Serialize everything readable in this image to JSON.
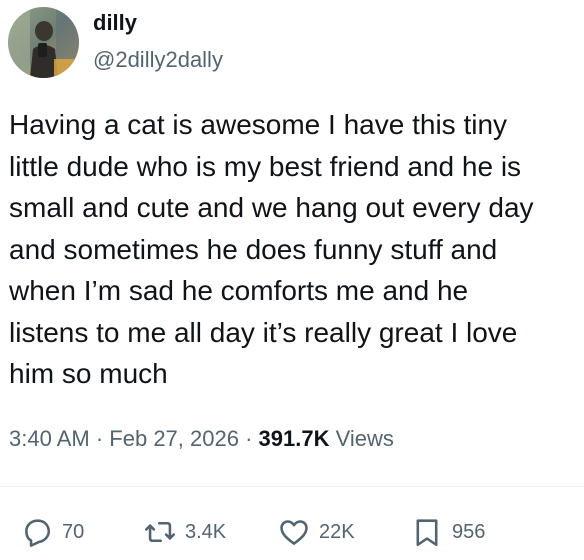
{
  "author": {
    "display_name": "dilly",
    "handle": "@2dilly2dally"
  },
  "tweet": {
    "text": "Having a cat is awesome I have this tiny\nlittle dude who is my best friend and he is\nsmall and cute and we hang out every day\nand sometimes he does funny stuff and\nwhen I’m sad he comforts me and he\nlistens to me all day it’s really great I love\nhim so much",
    "time": "3:40 AM",
    "date": "Feb 27, 2026",
    "views_count": "391.7K",
    "views_label": "Views",
    "separator": "·"
  },
  "actions": {
    "replies": "70",
    "reposts": "3.4K",
    "likes": "22K",
    "bookmarks": "956"
  },
  "icons": {
    "reply": "reply-bubble-icon",
    "repost": "repost-arrows-icon",
    "like": "heart-icon",
    "bookmark": "bookmark-icon"
  },
  "colors": {
    "text_primary": "#0f1419",
    "text_secondary": "#536471",
    "divider": "#eff3f4"
  }
}
